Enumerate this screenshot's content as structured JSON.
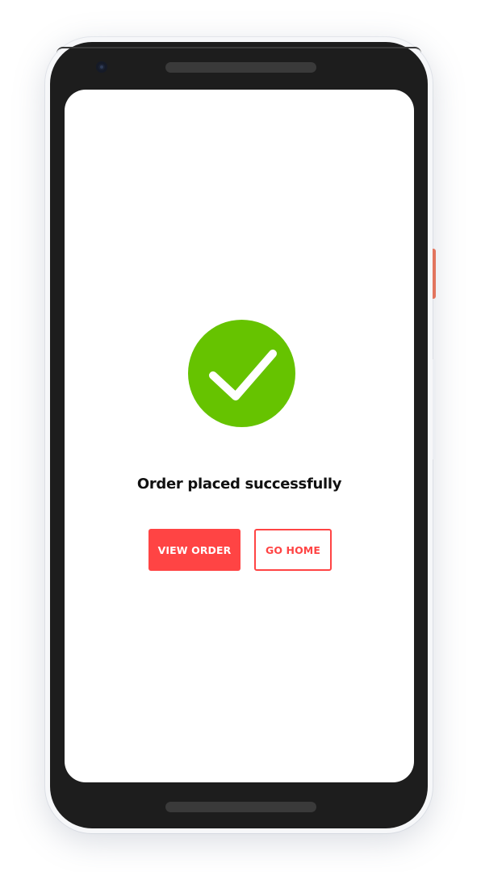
{
  "screen": {
    "success_icon": "check-circle-icon",
    "message": "Order placed successfully",
    "buttons": {
      "view_order": "VIEW ORDER",
      "go_home": "GO HOME"
    }
  },
  "colors": {
    "success": "#66c300",
    "accent": "#ff4444",
    "device_body": "#1d1d1d",
    "power_button": "#e2755e"
  }
}
